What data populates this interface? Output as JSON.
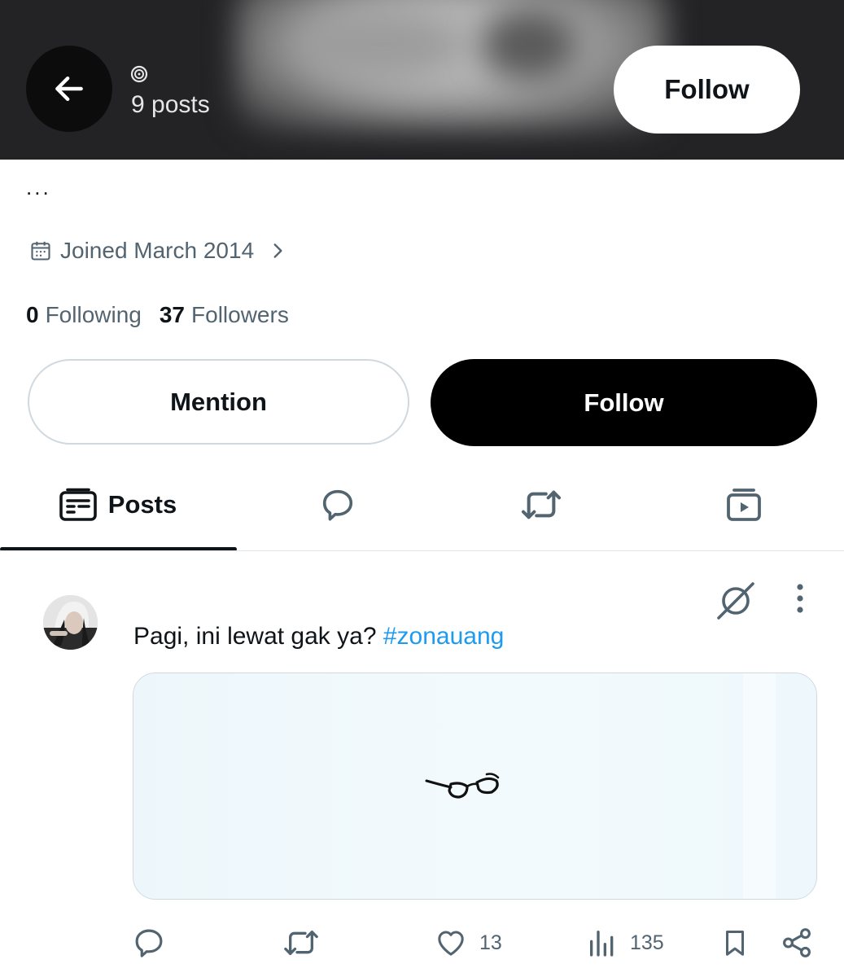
{
  "header": {
    "post_count": "9 posts",
    "follow_label": "Follow"
  },
  "profile": {
    "bio": "...",
    "joined": "Joined March 2014",
    "following_count": "0",
    "following_label": "Following",
    "followers_count": "37",
    "followers_label": "Followers"
  },
  "actions_row": {
    "mention_label": "Mention",
    "follow_label": "Follow"
  },
  "tabs": [
    {
      "label": "Posts",
      "icon": "posts-icon",
      "active": true
    },
    {
      "label": "",
      "icon": "replies-icon",
      "active": false
    },
    {
      "label": "",
      "icon": "reposts-icon",
      "active": false
    },
    {
      "label": "",
      "icon": "media-icon",
      "active": false
    }
  ],
  "post": {
    "text": "Pagi, ini lewat gak ya? ",
    "hashtag": "#zonauang",
    "media_icon": "glasses",
    "likes": "13",
    "views": "135"
  },
  "colors": {
    "accent": "#1d9bf0",
    "secondary_text": "#536471",
    "primary_text": "#0f1419",
    "header_bg": "#232326"
  }
}
